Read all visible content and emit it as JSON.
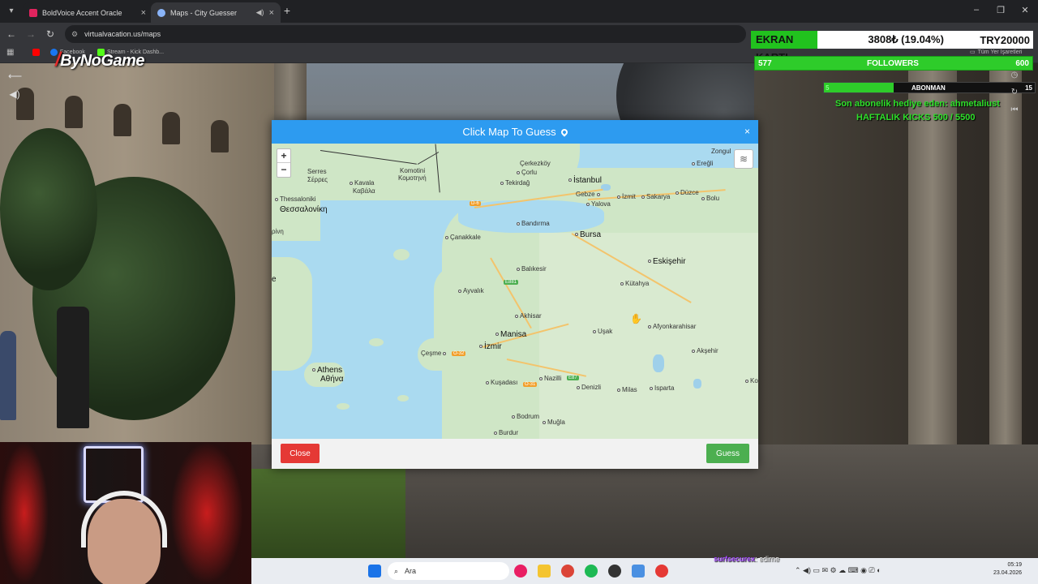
{
  "browser": {
    "tabs": [
      {
        "title": "BoldVoice Accent Oracle",
        "favicon_color": "#e0245e",
        "active": false
      },
      {
        "title": "Maps - City Guesser",
        "favicon_color": "#8ab4f8",
        "active": true
      }
    ],
    "url": "virtualvacation.us/maps",
    "bookmarks": [
      {
        "label": "",
        "icon": "youtube-icon",
        "color": "#ff0000"
      },
      {
        "label": "Facebook",
        "icon": "facebook-icon",
        "color": "#1877f2"
      },
      {
        "label": "Stream - Kick Dashb...",
        "icon": "kick-icon",
        "color": "#53fc18"
      }
    ],
    "all_bookmarks_label": "Tüm Yer İşaretleri"
  },
  "overlay": {
    "logo": "ByNoGame",
    "ekran": {
      "label": "EKRAN KARTI",
      "amount": "3808₺ (19.04%)",
      "goal": "TRY20000",
      "progress": 0.19
    },
    "followers": {
      "current": "577",
      "label": "FOLLOWERS",
      "goal": "600"
    },
    "abonman": {
      "current": "5",
      "label": "ABONMAN",
      "goal": "15",
      "progress": 0.33
    },
    "sub_message": "Son abonelik hediye eden: ahmetaliust",
    "kicks": "HAFTALIK KICKS 500 / 5500"
  },
  "modal": {
    "title": "Click Map To Guess",
    "close_x": "×",
    "close_button": "Close",
    "guess_button": "Guess",
    "zoom_in": "+",
    "zoom_out": "−"
  },
  "map": {
    "cities": [
      {
        "id": "istanbul",
        "name": "İstanbul",
        "big": true
      },
      {
        "id": "bursa",
        "name": "Bursa",
        "big": true
      },
      {
        "id": "eskisehir",
        "name": "Eskişehir",
        "big": true
      },
      {
        "id": "izmir",
        "name": "İzmir",
        "big": true
      },
      {
        "id": "athens",
        "name": "Athens",
        "big": true
      },
      {
        "id": "athens2",
        "name": "Αθήνα",
        "big": true
      },
      {
        "id": "thessaloniki",
        "name": "Thessaloniki",
        "big": true
      },
      {
        "id": "thessaloniki2",
        "name": "Θεσσαλονίκη",
        "big": true
      },
      {
        "id": "kutahya",
        "name": "Kütahya",
        "big": false
      },
      {
        "id": "balikesir",
        "name": "Balıkesir",
        "big": false
      },
      {
        "id": "manisa",
        "name": "Manisa",
        "big": false
      },
      {
        "id": "usak",
        "name": "Uşak",
        "big": false
      },
      {
        "id": "afyon",
        "name": "Afyonkarahisar",
        "big": false
      },
      {
        "id": "aksehir",
        "name": "Akşehir",
        "big": false
      },
      {
        "id": "denizli",
        "name": "Denizli",
        "big": false
      },
      {
        "id": "nazilli",
        "name": "Nazilli",
        "big": false
      },
      {
        "id": "isparta",
        "name": "Isparta",
        "big": false
      },
      {
        "id": "burdur",
        "name": "Burdur",
        "big": false
      },
      {
        "id": "mugla",
        "name": "Muğla",
        "big": false
      },
      {
        "id": "milas",
        "name": "Milas",
        "big": false
      },
      {
        "id": "bodrum",
        "name": "Bodrum",
        "big": false
      },
      {
        "id": "kusadasi",
        "name": "Kuşadası",
        "big": false
      },
      {
        "id": "cesme",
        "name": "Çeşme",
        "big": false
      },
      {
        "id": "ayvalik",
        "name": "Ayvalık",
        "big": false
      },
      {
        "id": "akhisar",
        "name": "Akhisar",
        "big": false
      },
      {
        "id": "canakkale",
        "name": "Çanakkale",
        "big": false
      },
      {
        "id": "bandirma",
        "name": "Bandırma",
        "big": false
      },
      {
        "id": "tekirdag",
        "name": "Tekirdağ",
        "big": false
      },
      {
        "id": "corlu",
        "name": "Çorlu",
        "big": false
      },
      {
        "id": "cerkezkoy",
        "name": "Çerkezköy",
        "big": false
      },
      {
        "id": "gebze",
        "name": "Gebze",
        "big": false
      },
      {
        "id": "izmit",
        "name": "İzmit",
        "big": false
      },
      {
        "id": "sakarya",
        "name": "Sakarya",
        "big": false
      },
      {
        "id": "duzce",
        "name": "Düzce",
        "big": false
      },
      {
        "id": "bolu",
        "name": "Bolu",
        "big": false
      },
      {
        "id": "eregli",
        "name": "Ereğli",
        "big": false
      },
      {
        "id": "zongul",
        "name": "Zongul",
        "big": false
      },
      {
        "id": "yalova",
        "name": "Yalova",
        "big": false
      },
      {
        "id": "kavala",
        "name": "Kavala",
        "big": false
      },
      {
        "id": "kavala2",
        "name": "Καβάλα",
        "big": false
      },
      {
        "id": "serres",
        "name": "Serres",
        "big": false
      },
      {
        "id": "serres2",
        "name": "Σέρρες",
        "big": false
      },
      {
        "id": "komotini",
        "name": "Komotini",
        "big": false
      },
      {
        "id": "komotini2",
        "name": "Κομοτηνή",
        "big": false
      },
      {
        "id": "edge_ko",
        "name": "Ko",
        "big": false
      },
      {
        "id": "edge_pin",
        "name": "ρίνη",
        "big": false
      },
      {
        "id": "edge_e",
        "name": "e",
        "big": true
      }
    ],
    "road_badges": [
      "D-6",
      "O-32",
      "O-31",
      "E87",
      "E881"
    ]
  },
  "webcam": {},
  "taskbar": {
    "search_placeholder": "Ara",
    "chat_user": "surfsecurex",
    "chat_text": ": edirne",
    "time": "05:19",
    "date": "23.04.2026"
  }
}
